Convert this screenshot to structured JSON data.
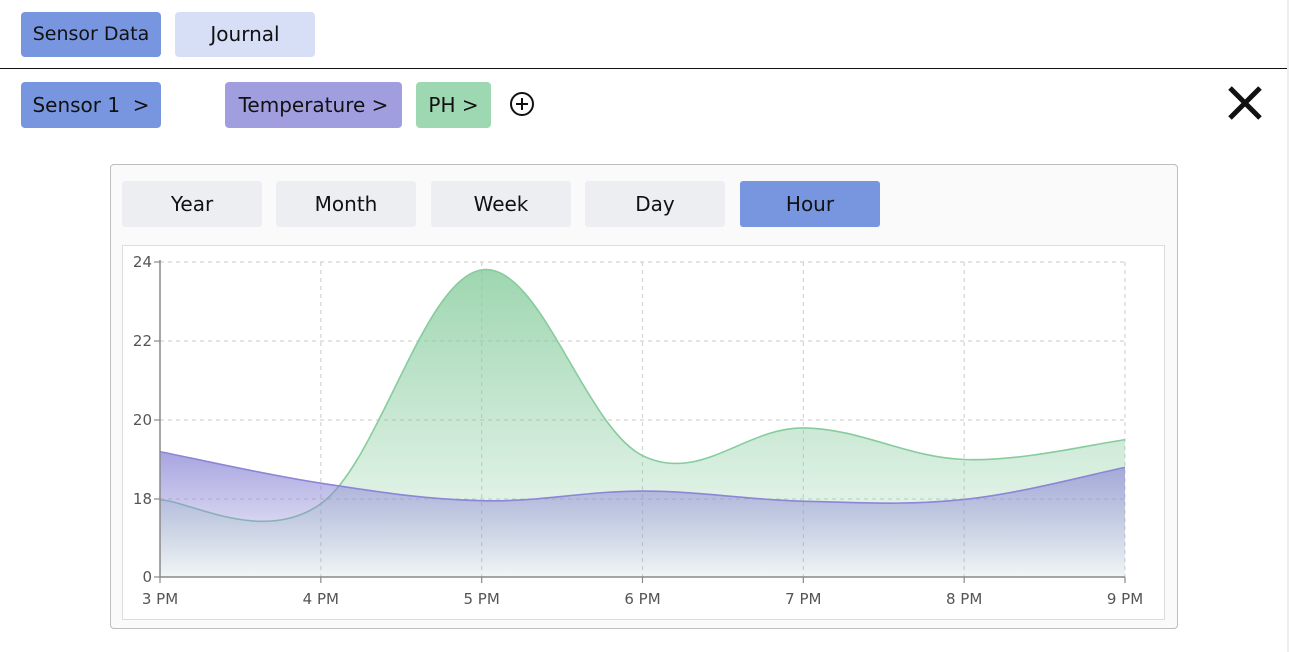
{
  "nav": {
    "tabs": [
      {
        "label": "Sensor Data",
        "active": true
      },
      {
        "label": "Journal",
        "active": false
      }
    ]
  },
  "filters": {
    "sensor_label": "Sensor 1  >",
    "metric_chips": [
      {
        "label": "Temperature >",
        "color": "#a19ee0"
      },
      {
        "label": "PH >",
        "color": "#9dd8b2"
      }
    ],
    "add_icon": "plus-circle-icon",
    "close_icon": "close-icon"
  },
  "time_ranges": [
    {
      "label": "Year",
      "active": false
    },
    {
      "label": "Month",
      "active": false
    },
    {
      "label": "Week",
      "active": false
    },
    {
      "label": "Day",
      "active": false
    },
    {
      "label": "Hour",
      "active": true
    }
  ],
  "chart_data": {
    "type": "area",
    "x": [
      "3 PM",
      "4 PM",
      "5 PM",
      "6 PM",
      "7 PM",
      "8 PM",
      "9 PM"
    ],
    "y_tick_labels": [
      "0",
      "18",
      "20",
      "22",
      "24"
    ],
    "ylim": [
      0,
      24
    ],
    "y_scale": "broken (0 then 18–24)",
    "grid": true,
    "series": [
      {
        "color": "#8b86d6",
        "values": [
          19.2,
          18.4,
          17.6,
          18.2,
          17.5,
          17.9,
          18.8
        ]
      },
      {
        "color": "#86cc9d",
        "values": [
          17.8,
          16.9,
          23.8,
          19.1,
          19.8,
          19.0,
          19.5
        ]
      }
    ]
  }
}
